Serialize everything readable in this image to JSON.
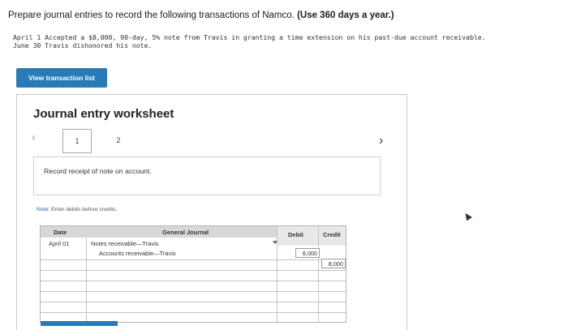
{
  "prompt": {
    "text": "Prepare journal entries to record the following transactions of Namco.",
    "emphasis": "(Use 360 days a year.)"
  },
  "transactions": [
    "April 1 Accepted a $8,000, 90-day, 5% note from Travis in granting a time extension on his past-due account receivable.",
    "June 30 Travis dishonored his note."
  ],
  "view_button_label": "View transaction list",
  "worksheet": {
    "title": "Journal entry worksheet",
    "prev_icon": "chevron-left-icon",
    "next_icon": "chevron-right-icon",
    "tabs": [
      {
        "label": "1"
      },
      {
        "label": "2"
      }
    ],
    "instruction": "Record receipt of note on account.",
    "note_label": "Note:",
    "note_text": "Enter debits before credits."
  },
  "journal": {
    "headers": {
      "date": "Date",
      "general_journal": "General Journal",
      "debit": "Debit",
      "credit": "Credit"
    },
    "rows": [
      {
        "date": "April 01",
        "account": "Notes receivable—Travis",
        "debit": "8,000",
        "credit": ""
      },
      {
        "date": "",
        "account": "Accounts receivable—Travis",
        "debit": "",
        "credit": "8,000"
      }
    ]
  },
  "colors": {
    "accent": "#2a7ab8"
  }
}
